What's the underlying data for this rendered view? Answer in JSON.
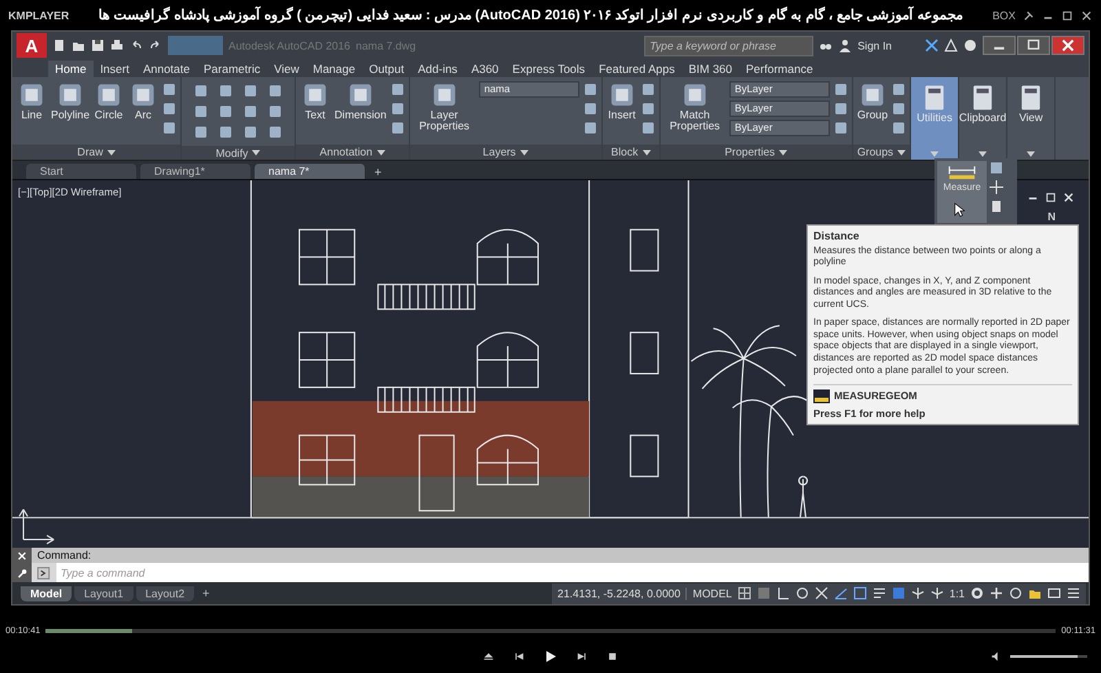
{
  "player": {
    "brand": "KMPLAYER",
    "video_title": "مجموعه آموزشی جامع ، گام به گام و کاربردی نرم افزار  اتوکد ۲۰۱۶ (AutoCAD 2016)  مدرس : سعید فدایی (تیچرمن ) گروه آموزشی پادشاه گرافیست ها",
    "box_label": "BOX",
    "elapsed": "00:10:41",
    "total": "00:11:31",
    "seek": {
      "level": 0.085
    },
    "volume": {
      "level": 0.88
    }
  },
  "app": {
    "logo": "A",
    "title": "Autodesk AutoCAD 2016",
    "file": "nama 7.dwg",
    "search": {
      "placeholder": "Type a keyword or phrase"
    },
    "sign_in": "Sign In"
  },
  "ribbon_tabs": [
    {
      "label": "Home",
      "selected": true
    },
    {
      "label": "Insert",
      "selected": false
    },
    {
      "label": "Annotate",
      "selected": false
    },
    {
      "label": "Parametric",
      "selected": false
    },
    {
      "label": "View",
      "selected": false
    },
    {
      "label": "Manage",
      "selected": false
    },
    {
      "label": "Output",
      "selected": false
    },
    {
      "label": "Add-ins",
      "selected": false
    },
    {
      "label": "A360",
      "selected": false
    },
    {
      "label": "Express Tools",
      "selected": false
    },
    {
      "label": "Featured Apps",
      "selected": false
    },
    {
      "label": "BIM 360",
      "selected": false
    },
    {
      "label": "Performance",
      "selected": false
    }
  ],
  "panels": [
    {
      "kind": "group",
      "title": "Draw",
      "tools": [
        "Line",
        "Polyline",
        "Circle",
        "Arc"
      ]
    },
    {
      "kind": "group",
      "title": "Modify"
    },
    {
      "kind": "group",
      "title": "Annotation",
      "tools": [
        "Text",
        "Dimension"
      ]
    },
    {
      "kind": "group",
      "title": "Layers",
      "tools": [
        "Layer Properties"
      ],
      "dropdowns": [
        "nama"
      ]
    },
    {
      "kind": "group",
      "title": "Block",
      "tools": [
        "Insert"
      ]
    },
    {
      "kind": "group",
      "title": "Properties",
      "tools": [
        "Match Properties"
      ],
      "dropdowns": [
        "ByLayer",
        "ByLayer",
        "ByLayer"
      ]
    },
    {
      "kind": "group",
      "title": "Groups",
      "tools": [
        "Group"
      ]
    },
    {
      "kind": "single",
      "label": "Utilities",
      "selected": true
    },
    {
      "kind": "single",
      "label": "Clipboard",
      "selected": false
    },
    {
      "kind": "single",
      "label": "View",
      "selected": false
    }
  ],
  "doc_tabs": [
    {
      "label": "Start",
      "selected": false
    },
    {
      "label": "Drawing1*",
      "selected": false
    },
    {
      "label": "nama 7*",
      "selected": true
    }
  ],
  "new_tab": "+",
  "viewport": {
    "label": "[−][Top][2D Wireframe]",
    "compass": "N"
  },
  "flyout": {
    "label": "Measure"
  },
  "tooltip": {
    "title": "Distance",
    "paragraphs": [
      "Measures the distance between two points or along a polyline",
      "In model space, changes in X, Y, and Z component distances and angles are measured in 3D relative to the current UCS.",
      "In paper space, distances are normally reported in 2D paper space units. However, when using object snaps on model space objects that are displayed in a single viewport, distances are reported as 2D model space distances projected onto a plane parallel to your screen."
    ],
    "command": "MEASUREGEOM",
    "help": "Press F1 for more help"
  },
  "command_line": {
    "history": "Command:",
    "placeholder": "Type a command"
  },
  "layout_tabs": [
    {
      "label": "Model",
      "selected": true
    },
    {
      "label": "Layout1",
      "selected": false
    },
    {
      "label": "Layout2",
      "selected": false
    }
  ],
  "layout_add": "+",
  "status_bar": {
    "coordinates": "21.4131, -5.2248, 0.0000",
    "space": "MODEL",
    "scale": "1:1"
  }
}
